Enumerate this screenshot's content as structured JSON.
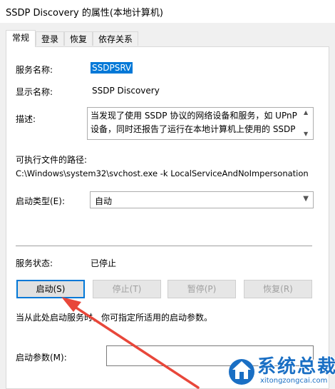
{
  "window": {
    "title": "SSDP Discovery 的属性(本地计算机)"
  },
  "tabs": [
    {
      "label": "常规"
    },
    {
      "label": "登录"
    },
    {
      "label": "恢复"
    },
    {
      "label": "依存关系"
    }
  ],
  "general": {
    "service_name_label": "服务名称:",
    "service_name_value": "SSDPSRV",
    "display_name_label": "显示名称:",
    "display_name_value": "SSDP Discovery",
    "description_label": "描述:",
    "description_line1": "当发现了使用 SSDP 协议的网络设备和服务，如 UPnP",
    "description_line2": "设备，同时还报告了运行在本地计算机上使用的 SSDP",
    "exe_path_label": "可执行文件的路径:",
    "exe_path_value": "C:\\Windows\\system32\\svchost.exe -k LocalServiceAndNoImpersonation",
    "startup_type_label": "启动类型(E):",
    "startup_type_value": "自动",
    "status_label": "服务状态:",
    "status_value": "已停止",
    "buttons": {
      "start": "启动(S)",
      "stop": "停止(T)",
      "pause": "暂停(P)",
      "resume": "恢复(R)"
    },
    "hint_text": "当从此处启动服务时，你可指定所适用的启动参数。",
    "start_params_label": "启动参数(M):",
    "start_params_value": ""
  },
  "watermark": {
    "title": "系统总裁",
    "url": "xitongzongcai.com"
  },
  "colors": {
    "selection": "#0078d7",
    "arrow": "#e8473a",
    "watermark": "#1a6fc4"
  }
}
